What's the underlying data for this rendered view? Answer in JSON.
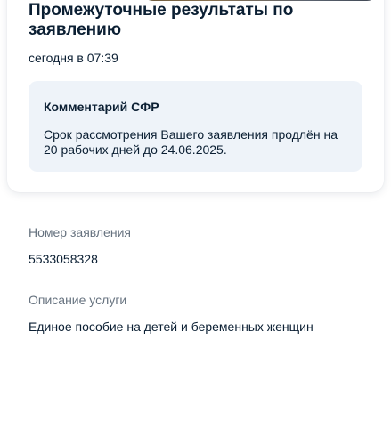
{
  "status_card": {
    "title": "Промежуточные результаты по заявлению",
    "date": "сегодня в 07:39",
    "comment": {
      "title": "Комментарий СФР",
      "text": "Срок рассмотрения Вашего заявления продлён на 20 рабочих дней до 24.06.2025."
    }
  },
  "application_number": {
    "label": "Номер заявления",
    "value": "5533058328"
  },
  "service_description": {
    "label": "Описание услуги",
    "value": "Единое пособие на детей и беременных женщин"
  }
}
